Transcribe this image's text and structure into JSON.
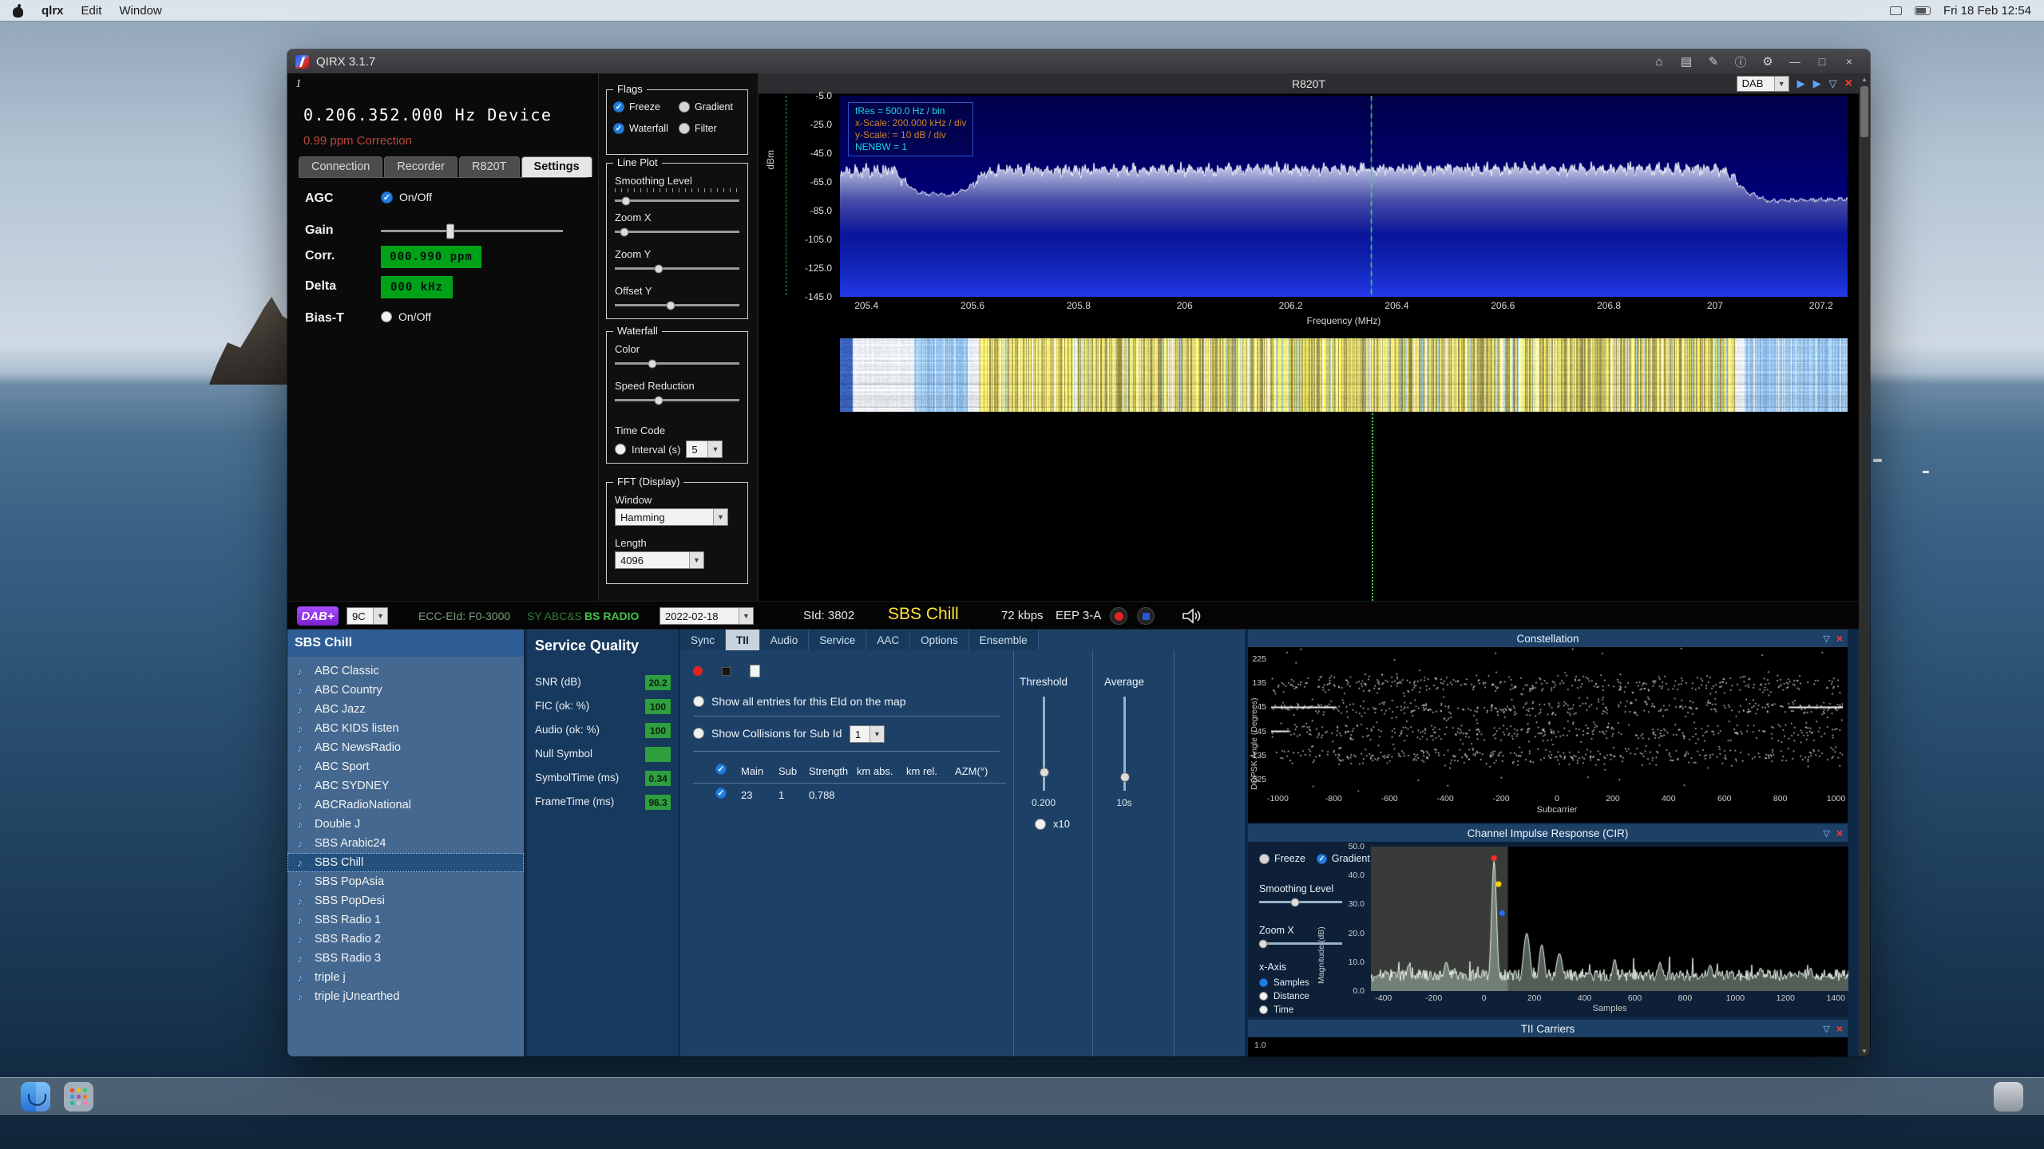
{
  "colors": {
    "lcd_green": "#00a318",
    "value_green": "#2f9e3f",
    "service_yellow": "#ffe437",
    "badge_purple": "#7a1fd0",
    "close_red": "#ff3b30",
    "accent_blue": "#1f7ddd",
    "tuned_green": "#3ecf3e"
  },
  "icons": {
    "dropdown": "▼",
    "check": "✓",
    "play": "▶",
    "funnel": "▽",
    "close": "×",
    "home": "⌂",
    "map": "▤",
    "pencil": "✎",
    "info": "ⓘ",
    "gear": "⚙",
    "minimize": "—",
    "maximize": "□",
    "note": "♪",
    "scroll_up": "▲",
    "scroll_down": "▼",
    "levels": "⋮"
  },
  "menu_bar": {
    "items": [
      "qlrx",
      "Edit",
      "Window"
    ],
    "clock": "Fri 18 Feb 12:54"
  },
  "window": {
    "title": "QIRX 3.1.7",
    "instance_label": "1"
  },
  "device_panel": {
    "frequency": "0.206.352.000 Hz Device",
    "correction": "0.99 ppm Correction",
    "tabs": [
      "Connection",
      "Recorder",
      "R820T",
      "Settings"
    ],
    "active_tab": "Settings",
    "settings": {
      "agc_label": "AGC",
      "agc_option": "On/Off",
      "agc_checked": true,
      "gain_label": "Gain",
      "gain_pct": 38,
      "corr_label": "Corr.",
      "corr_value": "000.990 ppm",
      "delta_label": "Delta",
      "delta_value": "000 kHz",
      "bias_label": "Bias-T",
      "bias_option": "On/Off",
      "bias_checked": false
    }
  },
  "display_controls": {
    "flags": {
      "title": "Flags",
      "options": [
        {
          "label": "Freeze",
          "checked": true
        },
        {
          "label": "Gradient",
          "checked": false
        },
        {
          "label": "Waterfall",
          "checked": true
        },
        {
          "label": "Filter",
          "checked": false
        }
      ]
    },
    "line_plot": {
      "title": "Line Plot",
      "sliders": [
        {
          "label": "Smoothing Level",
          "pct": 9,
          "ruler": true
        },
        {
          "label": "Zoom X",
          "pct": 8
        },
        {
          "label": "Zoom Y",
          "pct": 35
        },
        {
          "label": "Offset Y",
          "pct": 45
        }
      ]
    },
    "waterfall": {
      "title": "Waterfall",
      "sliders": [
        {
          "label": "Color",
          "pct": 30
        },
        {
          "label": "Speed Reduction",
          "pct": 35
        }
      ],
      "time_code_label": "Time Code",
      "interval_label": "Interval (s)",
      "interval_value": "5",
      "interval_checked": false
    },
    "fft": {
      "title": "FFT (Display)",
      "window_label": "Window",
      "window_value": "Hamming",
      "length_label": "Length",
      "length_value": "4096"
    }
  },
  "spectrum": {
    "header": "R820T",
    "mode": "DAB",
    "annotations": [
      "fRes = 500.0 Hz / bin",
      "x-Scale: 200.000 kHz / div",
      "y-Scale: = 10 dB / div",
      "NENBW = 1"
    ],
    "y_label": "dBm",
    "x_label": "Frequency (MHz)",
    "y_ticks": [
      "-5.0",
      "-25.0",
      "-45.0",
      "-65.0",
      "-85.0",
      "-105.0",
      "-125.0",
      "-145.0"
    ],
    "x_ticks": [
      "205.4",
      "205.6",
      "205.8",
      "206",
      "206.2",
      "206.4",
      "206.6",
      "206.8",
      "207",
      "207.2"
    ],
    "chart": {
      "type": "line",
      "x_range": [
        205.35,
        207.25
      ],
      "y_range": [
        -145,
        -5
      ],
      "tuned_mhz": 206.352,
      "ripple_db": 4.5,
      "envelope": [
        [
          205.35,
          -58
        ],
        [
          205.45,
          -57
        ],
        [
          205.47,
          -65
        ],
        [
          205.5,
          -73
        ],
        [
          205.56,
          -74
        ],
        [
          205.59,
          -70
        ],
        [
          205.62,
          -60
        ],
        [
          205.65,
          -57
        ],
        [
          206.4,
          -56
        ],
        [
          207.0,
          -56
        ],
        [
          207.03,
          -60
        ],
        [
          207.06,
          -72
        ],
        [
          207.1,
          -78
        ],
        [
          207.25,
          -77
        ]
      ]
    }
  },
  "dab_bar": {
    "mode_badge": "DAB+",
    "channel": "9C",
    "ecc_eid": "ECC-EId: F0-3000",
    "ensemble_sync": "SY ABC&S",
    "ensemble_name": "BS RADIO",
    "date": "2022-02-18",
    "sid": "SId: 3802",
    "service": "SBS Chill",
    "bitrate": "72 kbps",
    "protection": "EEP 3-A"
  },
  "stations": {
    "header": "SBS Chill",
    "selected": "SBS Chill",
    "items": [
      "ABC Classic",
      "ABC Country",
      "ABC Jazz",
      "ABC KIDS listen",
      "ABC NewsRadio",
      "ABC Sport",
      "ABC SYDNEY",
      "ABCRadioNational",
      "Double J",
      "SBS Arabic24",
      "SBS Chill",
      "SBS PopAsia",
      "SBS PopDesi",
      "SBS Radio 1",
      "SBS Radio 2",
      "SBS Radio 3",
      "triple j",
      "triple jUnearthed"
    ]
  },
  "service_quality": {
    "title": "Service Quality",
    "rows": [
      {
        "label": "SNR (dB)",
        "value": "20.2"
      },
      {
        "label": "FIC (ok: %)",
        "value": "100"
      },
      {
        "label": "Audio (ok: %)",
        "value": "100"
      },
      {
        "label": "Null Symbol",
        "value": ""
      },
      {
        "label": "SymbolTime (ms)",
        "value": "0.34"
      },
      {
        "label": "FrameTime (ms)",
        "value": "96.3"
      }
    ]
  },
  "tii": {
    "tabs": [
      "Sync",
      "TII",
      "Audio",
      "Service",
      "AAC",
      "Options",
      "Ensemble"
    ],
    "active_tab": "TII",
    "radio_all": "Show all entries for this EId on the map",
    "radio_collisions": "Show Collisions for Sub Id",
    "collisions_value": "1",
    "table": {
      "headers": [
        "Main",
        "Sub",
        "Strength",
        "km abs.",
        "km rel.",
        "AZM(°)"
      ],
      "rows": [
        [
          "23",
          "1",
          "0.788",
          "",
          "",
          ""
        ]
      ]
    },
    "threshold_label": "Threshold",
    "threshold_value": "0.200",
    "average_label": "Average",
    "average_value": "10s",
    "x10_label": "x10"
  },
  "constellation": {
    "title": "Constellation",
    "y_label": "DQPSK Angle (Degrees)",
    "x_label": "Subcarrier",
    "y_ticks": [
      "225",
      "135",
      "45",
      "-45",
      "-135",
      "-225"
    ],
    "x_ticks": [
      "-1000",
      "-800",
      "-600",
      "-400",
      "-200",
      "0",
      "200",
      "400",
      "600",
      "800",
      "1000"
    ],
    "chart": {
      "type": "scatter",
      "x_range": [
        -1024,
        1024
      ],
      "y_range": [
        -270,
        270
      ],
      "bands": [
        135,
        45,
        -45,
        -135
      ],
      "band_sigma": 17,
      "point_count": 1500,
      "line_segments": [
        [
          -1024,
          -790,
          45
        ],
        [
          830,
          1024,
          45
        ],
        [
          -1024,
          -960,
          -45
        ]
      ]
    }
  },
  "cir": {
    "title": "Channel Impulse Response (CIR)",
    "freeze_label": "Freeze",
    "freeze_checked": false,
    "gradient_label": "Gradient",
    "gradient_checked": true,
    "smoothing_label": "Smoothing Level",
    "smoothing_pct": 43,
    "zoom_label": "Zoom X",
    "zoom_pct": 5,
    "xaxis_label": "x-Axis",
    "xaxis_options": [
      "Samples",
      "Distance",
      "Time"
    ],
    "xaxis_selected": "Samples",
    "y_label": "Magnitude (dB)",
    "x_label": "Samples",
    "y_ticks": [
      "50.0",
      "40.0",
      "30.0",
      "20.0",
      "10.0",
      "0.0"
    ],
    "x_ticks": [
      "-400",
      "-200",
      "0",
      "200",
      "400",
      "600",
      "800",
      "1000",
      "1200",
      "1400"
    ],
    "chart": {
      "type": "line",
      "x_range": [
        -450,
        1450
      ],
      "y_range": [
        0,
        50
      ],
      "shade_to_x": 95,
      "peaks": [
        [
          40,
          45,
          10
        ],
        [
          170,
          20,
          14
        ],
        [
          230,
          16,
          12
        ],
        [
          300,
          13,
          14
        ],
        [
          520,
          11,
          10
        ],
        [
          700,
          10,
          10
        ],
        [
          -150,
          10,
          12
        ],
        [
          -300,
          9,
          10
        ],
        [
          900,
          9,
          12
        ],
        [
          1100,
          8,
          10
        ],
        [
          1300,
          8,
          10
        ]
      ],
      "markers": [
        {
          "x": 40,
          "y": 46,
          "color": "#ff2a2a"
        },
        {
          "x": 58,
          "y": 37,
          "color": "#ffd400"
        },
        {
          "x": 72,
          "y": 27,
          "color": "#2a6bff"
        }
      ]
    }
  },
  "tii_carriers": {
    "title": "TII Carriers",
    "partial_tick": "1.0"
  }
}
